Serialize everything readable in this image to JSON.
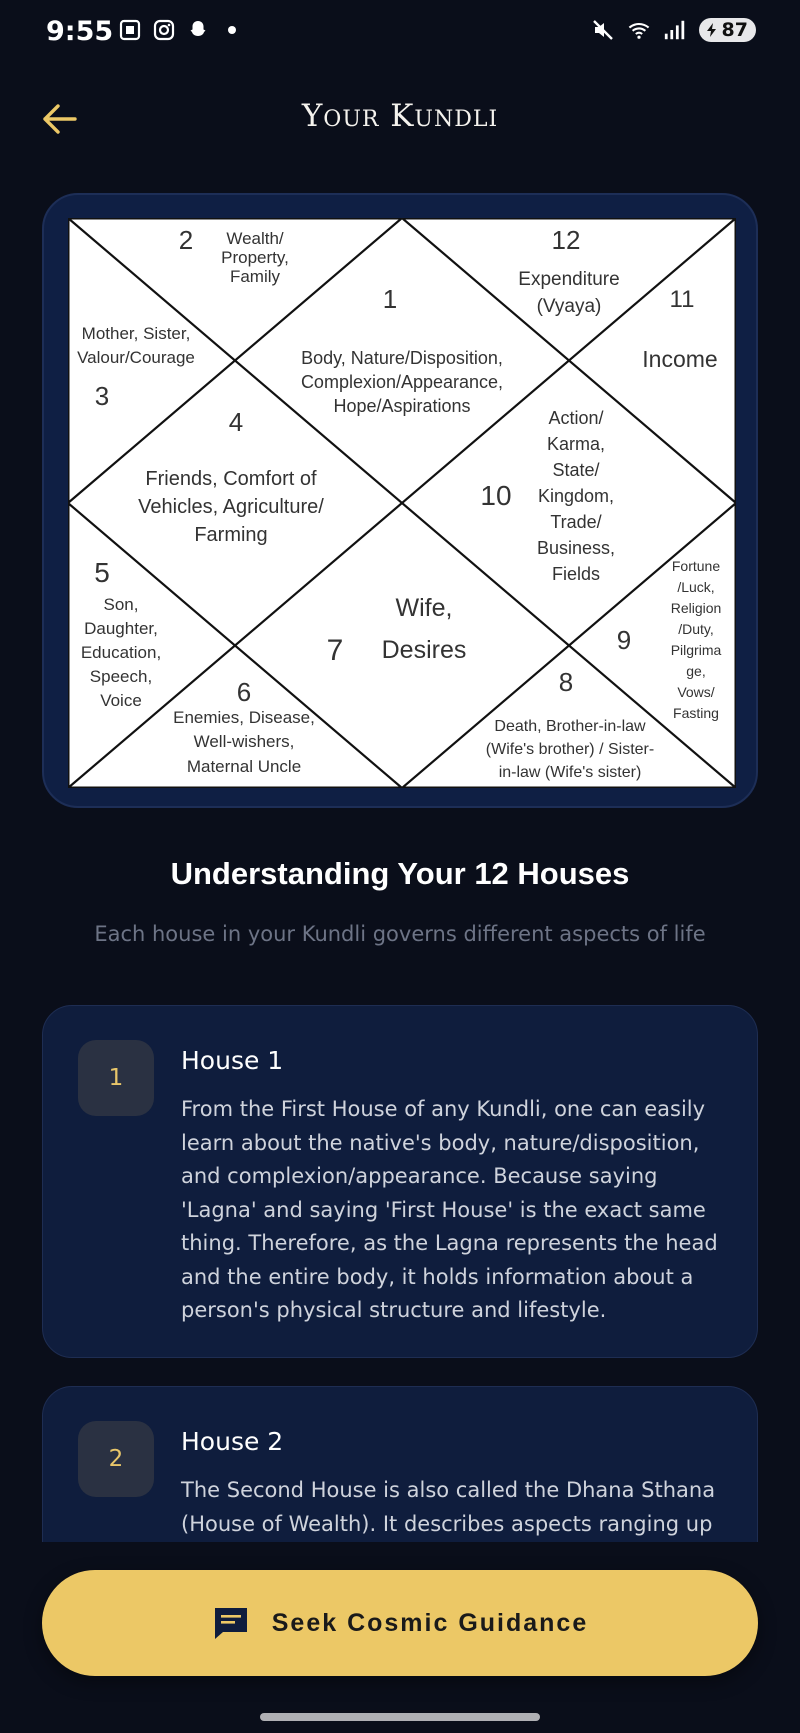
{
  "status_bar": {
    "time": "9:55",
    "battery": "87",
    "icons": [
      "screenshot-icon",
      "instagram-icon",
      "snapchat-icon",
      "dot-icon",
      "mute-icon",
      "wifi-icon",
      "signal-icon",
      "battery-icon"
    ]
  },
  "header": {
    "title": "Your Kundli",
    "back_icon": "arrow-left-icon"
  },
  "chart": {
    "houses": [
      {
        "num": "1",
        "lines": [
          "Body, Nature/Disposition,",
          "Complexion/Appearance,",
          "Hope/Aspirations"
        ]
      },
      {
        "num": "2",
        "lines": [
          "Wealth/",
          "Property,",
          "Family"
        ]
      },
      {
        "num": "3",
        "lines": [
          "Mother, Sister,",
          "Valour/Courage"
        ]
      },
      {
        "num": "4",
        "lines": [
          "Friends, Comfort of",
          "Vehicles, Agriculture/",
          "Farming"
        ]
      },
      {
        "num": "5",
        "lines": [
          "Son,",
          "Daughter,",
          "Education,",
          "Speech,",
          "Voice"
        ]
      },
      {
        "num": "6",
        "lines": [
          "Enemies, Disease,",
          "Well-wishers,",
          "Maternal Uncle"
        ]
      },
      {
        "num": "7",
        "lines": [
          "Wife,",
          "Desires"
        ]
      },
      {
        "num": "8",
        "lines": [
          "Death, Brother-in-law",
          "(Wife's brother) / Sister-",
          "in-law (Wife's sister)"
        ]
      },
      {
        "num": "9",
        "lines": [
          "Fortune",
          "/Luck,",
          "Religion",
          "/Duty,",
          "Pilgrima",
          "ge,",
          "Vows/",
          "Fasting"
        ]
      },
      {
        "num": "10",
        "lines": [
          "Action/",
          "Karma,",
          "State/",
          "Kingdom,",
          "Trade/",
          "Business,",
          "Fields"
        ]
      },
      {
        "num": "11",
        "lines": [
          "Income"
        ]
      },
      {
        "num": "12",
        "lines": [
          "Expenditure",
          "(Vyaya)"
        ]
      }
    ]
  },
  "section": {
    "title": "Understanding Your 12 Houses",
    "subtitle": "Each house in your Kundli governs different aspects of life"
  },
  "cards": [
    {
      "num": "1",
      "name": "House 1",
      "description": "From the First House of any Kundli, one can easily learn about the native's body, nature/disposition, and complexion/appearance. Because saying 'Lagna' and saying 'First House' is the exact same thing. Therefore, as the Lagna represents the head and the entire body, it holds information about a person's physical structure and lifestyle."
    },
    {
      "num": "2",
      "name": "House 2",
      "description": "The Second House is also called the Dhana Sthana (House of Wealth). It describes aspects ranging up"
    }
  ],
  "cta": {
    "label": "Seek Cosmic Guidance",
    "icon": "chat-icon"
  },
  "colors": {
    "background": "#0a0e1a",
    "card": "#0f1d3d",
    "accent": "#ecc866",
    "house_badge_text": "#e8c66a"
  }
}
